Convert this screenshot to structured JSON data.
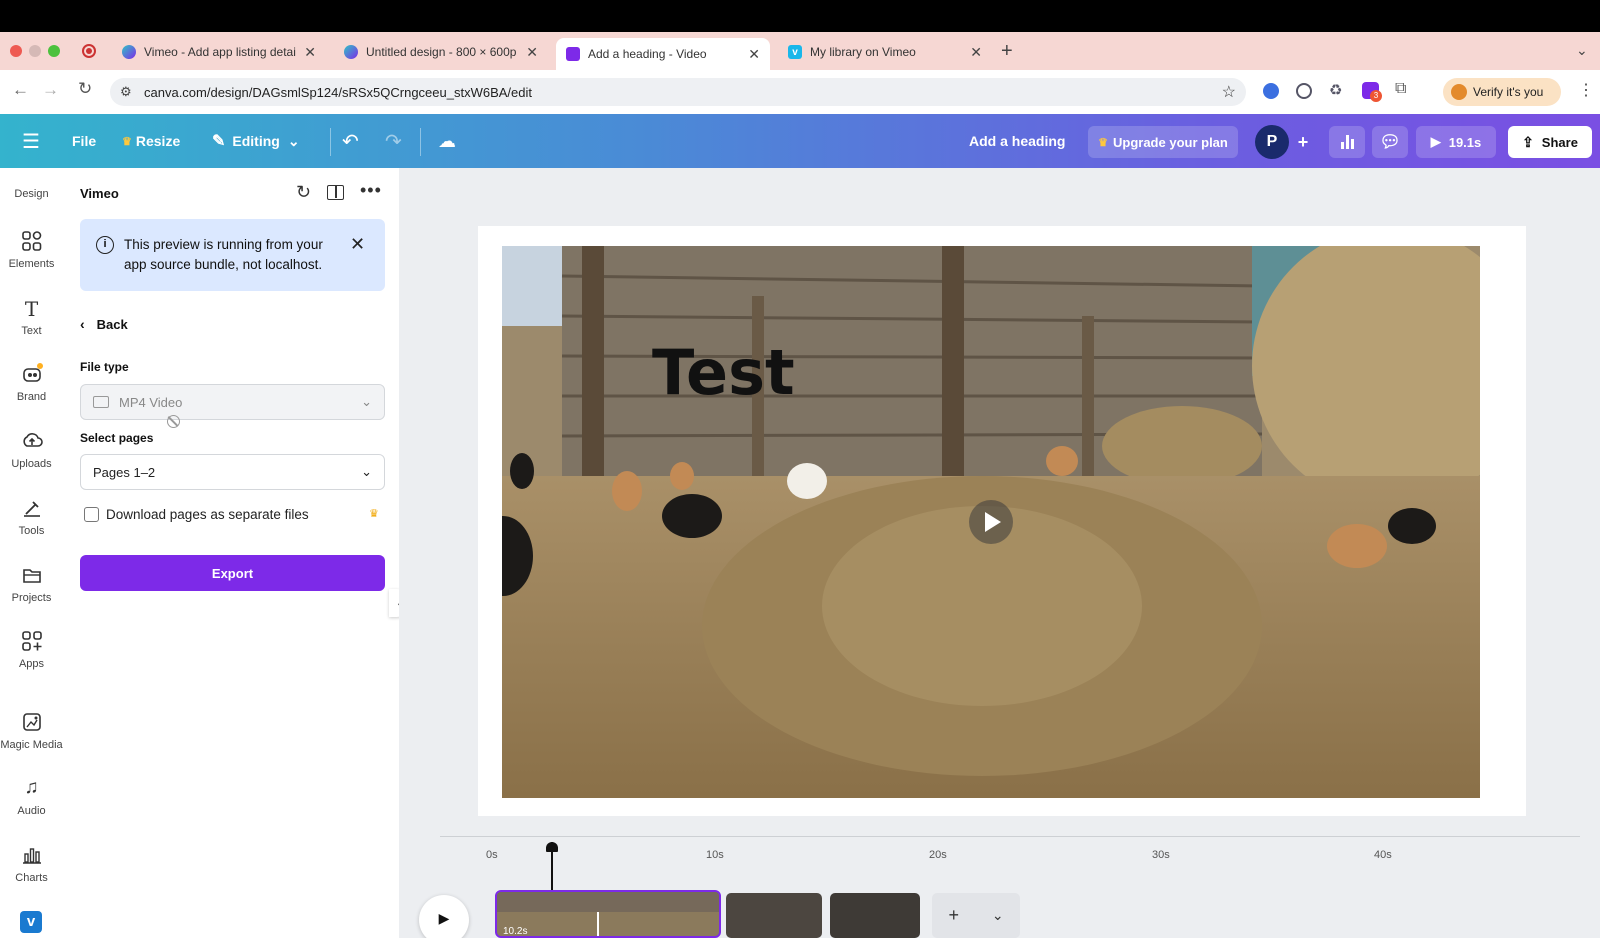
{
  "browser": {
    "tabs": [
      {
        "label": "Vimeo - Add app listing detai",
        "icon": "canva-icon"
      },
      {
        "label": "Untitled design - 800 × 600p",
        "icon": "canva-icon"
      },
      {
        "label": "Add a heading - Video",
        "icon": "canva-video-icon",
        "active": true
      },
      {
        "label": "My library on Vimeo",
        "icon": "vimeo-icon"
      }
    ],
    "url": "canva.com/design/DAGsmlSp124/sRSx5QCrngceeu_stxW6BA/edit",
    "verify_label": "Verify it's you",
    "extension_badge": "3"
  },
  "toolbar": {
    "file_label": "File",
    "resize_label": "Resize",
    "editing_label": "Editing",
    "design_title": "Add a heading",
    "upgrade_label": "Upgrade your plan",
    "avatar_letter": "P",
    "play_duration": "19.1s",
    "share_label": "Share"
  },
  "rail": {
    "items": [
      {
        "label": "Design",
        "icon": "design-icon"
      },
      {
        "label": "Elements",
        "icon": "elements-icon"
      },
      {
        "label": "Text",
        "icon": "text-icon"
      },
      {
        "label": "Brand",
        "icon": "brand-icon"
      },
      {
        "label": "Uploads",
        "icon": "uploads-icon"
      },
      {
        "label": "Tools",
        "icon": "tools-icon"
      },
      {
        "label": "Projects",
        "icon": "projects-icon"
      },
      {
        "label": "Apps",
        "icon": "apps-icon"
      },
      {
        "label": "Magic Media",
        "icon": "magic-media-icon"
      },
      {
        "label": "Audio",
        "icon": "audio-icon"
      },
      {
        "label": "Charts",
        "icon": "charts-icon"
      }
    ]
  },
  "panel": {
    "title": "Vimeo",
    "notice_text": "This preview is running from your app source bundle, not localhost.",
    "back_label": "Back",
    "file_type_label": "File type",
    "file_type_value": "MP4 Video",
    "select_pages_label": "Select pages",
    "select_pages_value": "Pages 1–2",
    "separate_files_label": "Download pages as separate files",
    "separate_files_checked": false,
    "export_label": "Export"
  },
  "canvas": {
    "heading_text": "Test"
  },
  "timeline": {
    "ticks": [
      "0s",
      "10s",
      "20s",
      "30s",
      "40s"
    ],
    "clip_duration": "10.2s"
  },
  "colors": {
    "accent": "#7d2ae8",
    "notice_bg": "#dbe8ff",
    "tab_strip": "#f6d7d3"
  }
}
